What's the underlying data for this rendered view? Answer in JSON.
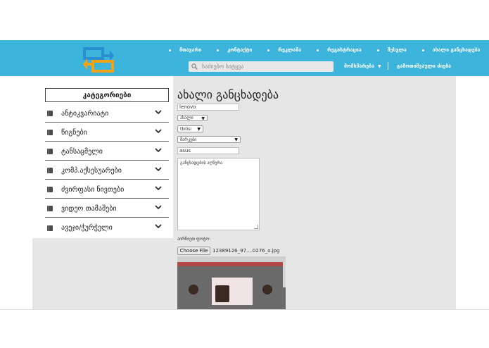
{
  "nav": {
    "items": [
      {
        "label": "მთავარი"
      },
      {
        "label": "კონტაქტი"
      },
      {
        "label": "რეკლამა"
      },
      {
        "label": "რეგისტრაცია"
      },
      {
        "label": "შესვლა"
      },
      {
        "label": "ახალი განცხადება"
      }
    ],
    "search_placeholder": "საძიებო სიტყვა",
    "dropdown_label": "მომხმარება",
    "login_label": "გამოთიშვაული ძიება"
  },
  "sidebar": {
    "title": "კატეგორიები",
    "items": [
      {
        "label": "ანტიკვარიატი"
      },
      {
        "label": "წიგნები"
      },
      {
        "label": "ტანსაცმელი"
      },
      {
        "label": "კომპ.აქსესუარები"
      },
      {
        "label": "ძვირფასი ნივთები"
      },
      {
        "label": "ვიდეო თამაშები"
      },
      {
        "label": "ავეჯი/ჭურჭელი"
      }
    ]
  },
  "form": {
    "title": "ახალი განცხადება",
    "name_value": "lenovo",
    "condition_select": "ახალი",
    "city_select": "tbilisi",
    "brand_select": "მარკები",
    "model_value": "asus",
    "description_placeholder": "განცხადების აღწერა",
    "photo_label": "აირჩიეთ ფოტო:",
    "choose_button": "Choose File",
    "file_name": "12389126_97....0276_o.jpg"
  },
  "colors": {
    "header_bg": "#3cb4dc",
    "content_bg": "#e6e6e6",
    "logo_blue": "#2a8fd0",
    "logo_orange": "#f2a413"
  }
}
